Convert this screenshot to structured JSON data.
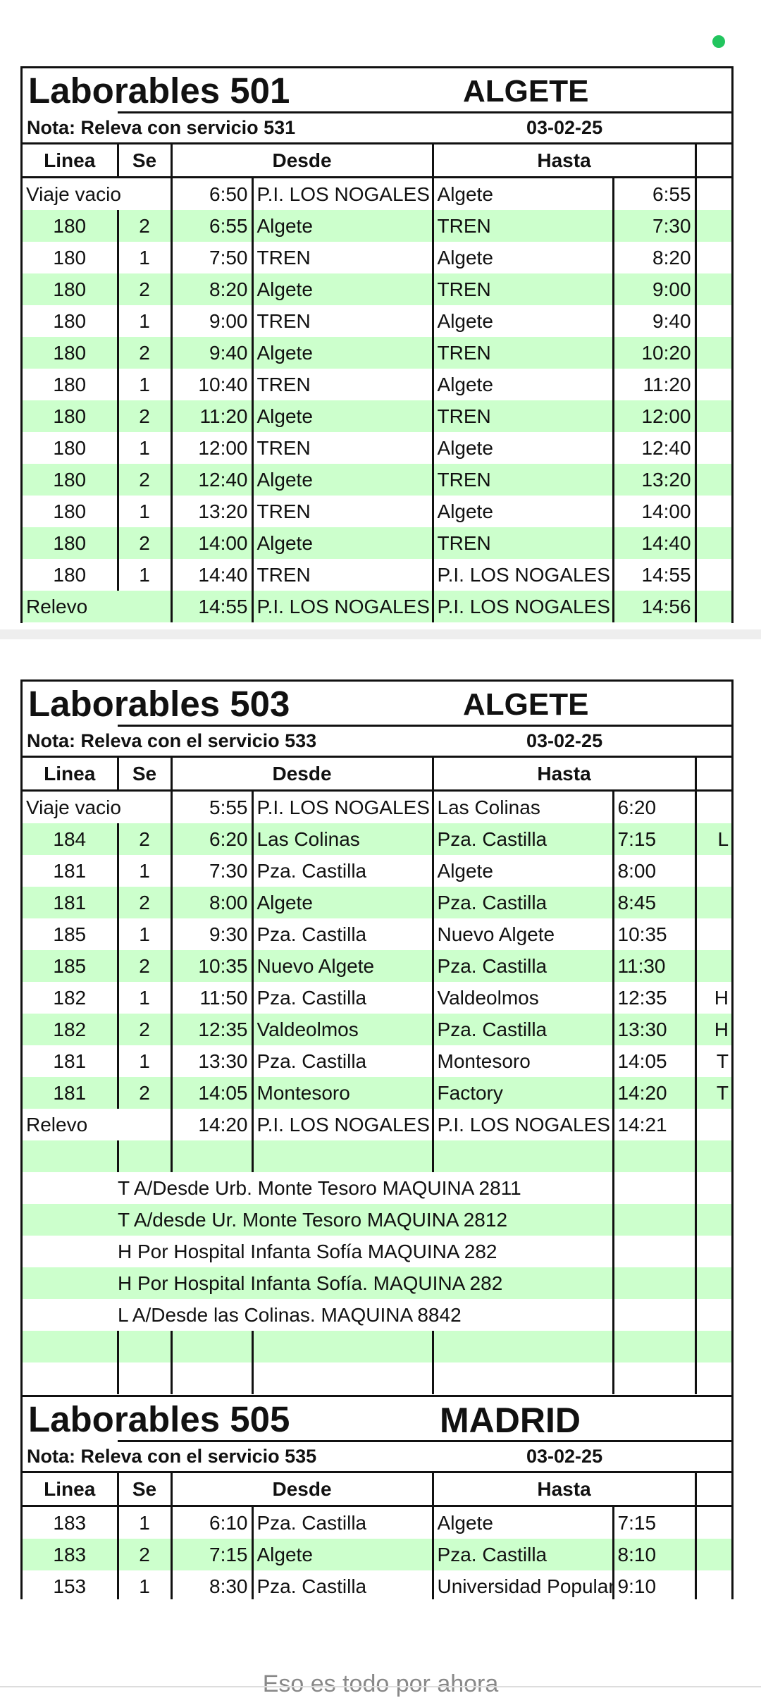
{
  "sheets": [
    {
      "title": "Laborables 501",
      "place": "ALGETE",
      "note": "Nota: Releva con servicio 531",
      "date": "03-02-25",
      "headers": [
        "Linea",
        "Se",
        "Desde",
        "Hasta"
      ],
      "rows": [
        {
          "linea": "Viaje vacio",
          "se": "",
          "hora": "6:50",
          "desde": "P.I. LOS NOGALES",
          "hasta": "Algete",
          "hora2": "6:55",
          "marca": ""
        },
        {
          "linea": "180",
          "se": "2",
          "hora": "6:55",
          "desde": "Algete",
          "hasta": "TREN",
          "hora2": "7:30",
          "marca": ""
        },
        {
          "linea": "180",
          "se": "1",
          "hora": "7:50",
          "desde": "TREN",
          "hasta": "Algete",
          "hora2": "8:20",
          "marca": ""
        },
        {
          "linea": "180",
          "se": "2",
          "hora": "8:20",
          "desde": "Algete",
          "hasta": "TREN",
          "hora2": "9:00",
          "marca": ""
        },
        {
          "linea": "180",
          "se": "1",
          "hora": "9:00",
          "desde": "TREN",
          "hasta": "Algete",
          "hora2": "9:40",
          "marca": ""
        },
        {
          "linea": "180",
          "se": "2",
          "hora": "9:40",
          "desde": "Algete",
          "hasta": "TREN",
          "hora2": "10:20",
          "marca": ""
        },
        {
          "linea": "180",
          "se": "1",
          "hora": "10:40",
          "desde": "TREN",
          "hasta": "Algete",
          "hora2": "11:20",
          "marca": ""
        },
        {
          "linea": "180",
          "se": "2",
          "hora": "11:20",
          "desde": "Algete",
          "hasta": "TREN",
          "hora2": "12:00",
          "marca": ""
        },
        {
          "linea": "180",
          "se": "1",
          "hora": "12:00",
          "desde": "TREN",
          "hasta": "Algete",
          "hora2": "12:40",
          "marca": ""
        },
        {
          "linea": "180",
          "se": "2",
          "hora": "12:40",
          "desde": "Algete",
          "hasta": "TREN",
          "hora2": "13:20",
          "marca": ""
        },
        {
          "linea": "180",
          "se": "1",
          "hora": "13:20",
          "desde": "TREN",
          "hasta": "Algete",
          "hora2": "14:00",
          "marca": ""
        },
        {
          "linea": "180",
          "se": "2",
          "hora": "14:00",
          "desde": "Algete",
          "hasta": "TREN",
          "hora2": "14:40",
          "marca": ""
        },
        {
          "linea": "180",
          "se": "1",
          "hora": "14:40",
          "desde": "TREN",
          "hasta": "P.I. LOS NOGALES",
          "hora2": "14:55",
          "marca": ""
        },
        {
          "linea": "Relevo",
          "se": "",
          "hora": "14:55",
          "desde": "P.I. LOS NOGALES",
          "hasta": "P.I. LOS NOGALES",
          "hora2": "14:56",
          "marca": ""
        }
      ]
    },
    {
      "title": "Laborables 503",
      "place": "ALGETE",
      "note": "Nota: Releva con el servicio 533",
      "date": "03-02-25",
      "headers": [
        "Linea",
        "Se",
        "Desde",
        "Hasta"
      ],
      "rows": [
        {
          "linea": "Viaje vacio",
          "se": "",
          "hora": "5:55",
          "desde": "P.I. LOS NOGALES",
          "hasta": "Las Colinas",
          "hora2": "6:20",
          "marca": ""
        },
        {
          "linea": "184",
          "se": "2",
          "hora": "6:20",
          "desde": "Las Colinas",
          "hasta": "Pza. Castilla",
          "hora2": "7:15",
          "marca": "L"
        },
        {
          "linea": "181",
          "se": "1",
          "hora": "7:30",
          "desde": "Pza. Castilla",
          "hasta": "Algete",
          "hora2": "8:00",
          "marca": ""
        },
        {
          "linea": "181",
          "se": "2",
          "hora": "8:00",
          "desde": "Algete",
          "hasta": "Pza. Castilla",
          "hora2": "8:45",
          "marca": ""
        },
        {
          "linea": "185",
          "se": "1",
          "hora": "9:30",
          "desde": "Pza. Castilla",
          "hasta": "Nuevo Algete",
          "hora2": "10:35",
          "marca": ""
        },
        {
          "linea": "185",
          "se": "2",
          "hora": "10:35",
          "desde": "Nuevo Algete",
          "hasta": "Pza. Castilla",
          "hora2": "11:30",
          "marca": ""
        },
        {
          "linea": "182",
          "se": "1",
          "hora": "11:50",
          "desde": "Pza. Castilla",
          "hasta": "Valdeolmos",
          "hora2": "12:35",
          "marca": "H"
        },
        {
          "linea": "182",
          "se": "2",
          "hora": "12:35",
          "desde": "Valdeolmos",
          "hasta": "Pza. Castilla",
          "hora2": "13:30",
          "marca": "H"
        },
        {
          "linea": "181",
          "se": "1",
          "hora": "13:30",
          "desde": "Pza. Castilla",
          "hasta": "Montesoro",
          "hora2": "14:05",
          "marca": "T"
        },
        {
          "linea": "181",
          "se": "2",
          "hora": "14:05",
          "desde": "Montesoro",
          "hasta": "Factory",
          "hora2": "14:20",
          "marca": "T"
        },
        {
          "linea": "Relevo",
          "se": "",
          "hora": "14:20",
          "desde": "P.I. LOS NOGALES",
          "hasta": "P.I. LOS NOGALES",
          "hora2": "14:21",
          "marca": ""
        }
      ],
      "notes": [
        "T A/Desde Urb. Monte Tesoro  MAQUINA 2811",
        "T A/desde Ur. Monte Tesoro  MAQUINA  2812",
        "H Por Hospital Infanta Sofía MAQUINA 282",
        "H Por Hospital Infanta Sofía. MAQUINA 282",
        "L A/Desde las Colinas. MAQUINA 8842"
      ]
    },
    {
      "title": "Laborables 505",
      "place": "MADRID",
      "note": "Nota: Releva con el servicio 535",
      "date": "03-02-25",
      "headers": [
        "Linea",
        "Se",
        "Desde",
        "Hasta"
      ],
      "rows": [
        {
          "linea": "183",
          "se": "1",
          "hora": "6:10",
          "desde": "Pza. Castilla",
          "hasta": "Algete",
          "hora2": "7:15",
          "marca": ""
        },
        {
          "linea": "183",
          "se": "2",
          "hora": "7:15",
          "desde": "Algete",
          "hasta": "Pza. Castilla",
          "hora2": "8:10",
          "marca": ""
        },
        {
          "linea": "153",
          "se": "1",
          "hora": "8:30",
          "desde": "Pza. Castilla",
          "hasta": "Universidad Popular",
          "hora2": "9:10",
          "marca": ""
        }
      ]
    }
  ],
  "footer": {
    "text": "Eso es todo por ahora"
  }
}
